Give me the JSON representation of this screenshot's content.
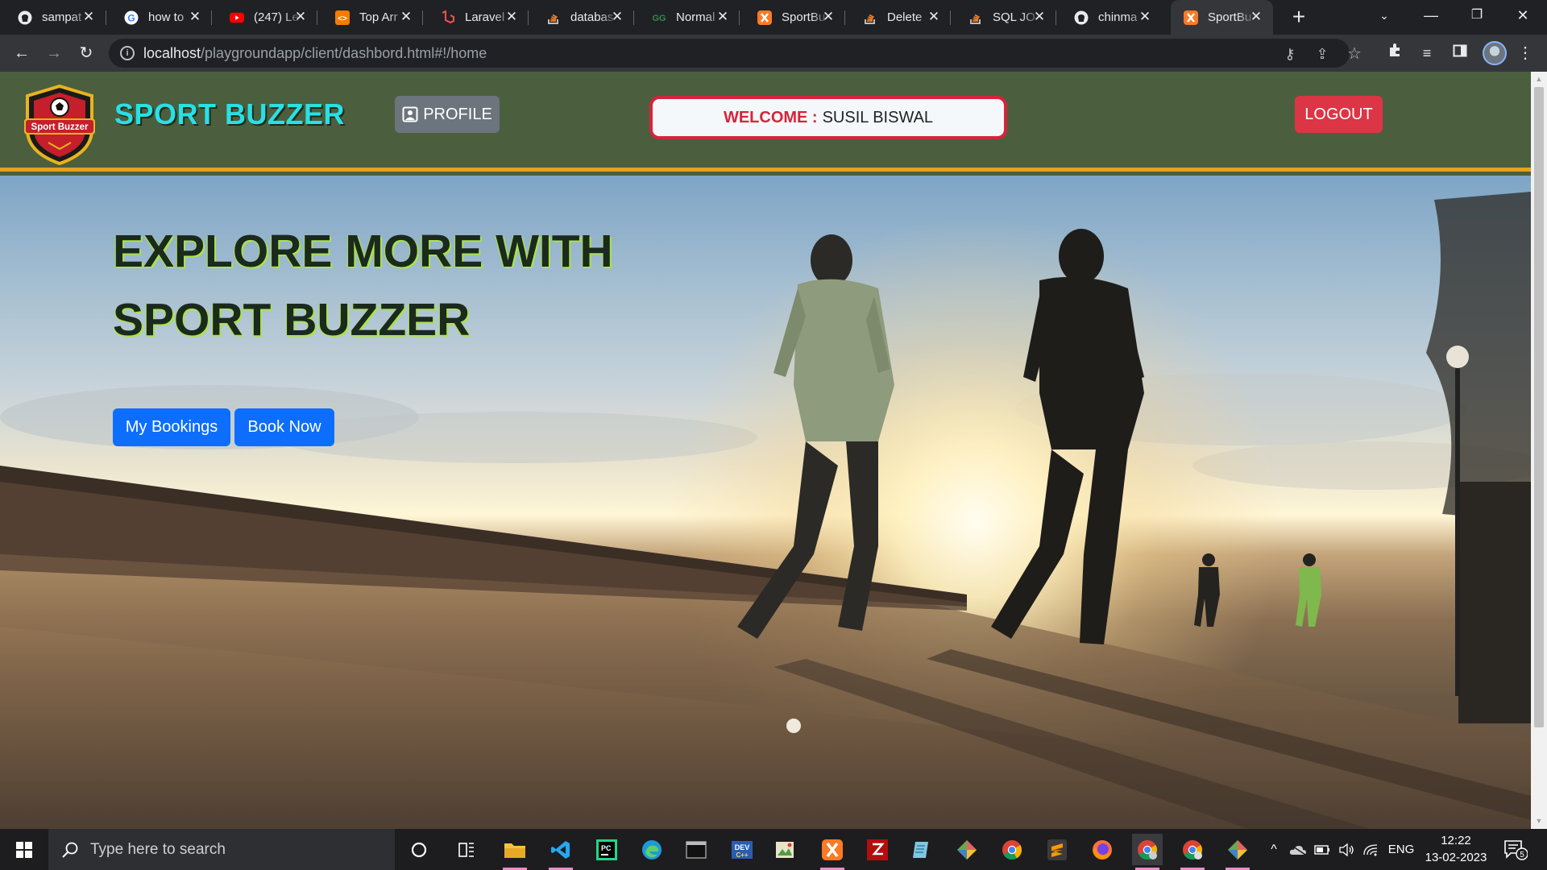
{
  "browser": {
    "tabs": [
      {
        "title": "sampat",
        "icon": "github-icon"
      },
      {
        "title": "how to",
        "icon": "google-icon"
      },
      {
        "title": "(247) Le",
        "icon": "youtube-icon"
      },
      {
        "title": "Top Arr",
        "icon": "site-icon"
      },
      {
        "title": "Laravel",
        "icon": "laravel-icon"
      },
      {
        "title": "databas",
        "icon": "stackoverflow-icon"
      },
      {
        "title": "Normal",
        "icon": "site-icon"
      },
      {
        "title": "SportBu",
        "icon": "xampp-icon"
      },
      {
        "title": "Delete",
        "icon": "stackoverflow-icon"
      },
      {
        "title": "SQL JO",
        "icon": "stackoverflow-icon"
      },
      {
        "title": "chinma",
        "icon": "github-icon"
      },
      {
        "title": "SportBu",
        "icon": "xampp-icon",
        "active": true
      }
    ],
    "url_host": "localhost",
    "url_path": "/playgroundapp/client/dashbord.html#!/home"
  },
  "navbar": {
    "brand": "SPORT BUZZER",
    "logo_text": "Sport Buzzer",
    "profile_label": "PROFILE",
    "welcome_label": "WELCOME :",
    "welcome_name": "SUSIL BISWAL",
    "logout_label": "LOGOUT"
  },
  "hero": {
    "title_line1": "EXPLORE MORE WITH",
    "title_line2": "SPORT BUZZER",
    "my_bookings_label": "My Bookings",
    "book_now_label": "Book Now"
  },
  "taskbar": {
    "search_placeholder": "Type here to search",
    "language": "ENG",
    "time": "12:22",
    "date": "13-02-2023",
    "notification_count": "5"
  },
  "colors": {
    "navbar_bg": "#4b5f3e",
    "navbar_border": "#e6a11c",
    "brand": "#28e0e6",
    "welcome_border": "#d4253a",
    "logout_bg": "#dc3545",
    "profile_bg": "#6c757d",
    "primary_button": "#0d6efd"
  }
}
